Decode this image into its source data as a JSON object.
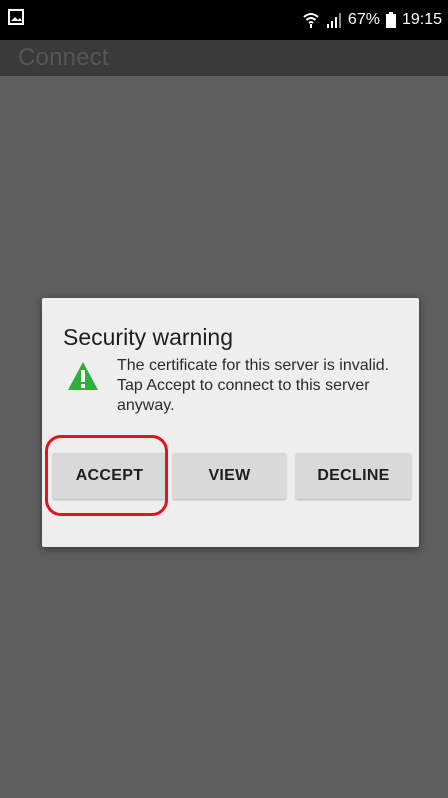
{
  "status_bar": {
    "battery": "67%",
    "time": "19:15"
  },
  "app_bar": {
    "title": "Connect"
  },
  "dialog": {
    "title": "Security warning",
    "message": "The certificate for this server is invalid. Tap Accept to connect to this server anyway.",
    "buttons": {
      "accept": "ACCEPT",
      "view": "VIEW",
      "decline": "DECLINE"
    },
    "highlight_color": "#e0161e",
    "warning_color": "#2fae3a"
  }
}
